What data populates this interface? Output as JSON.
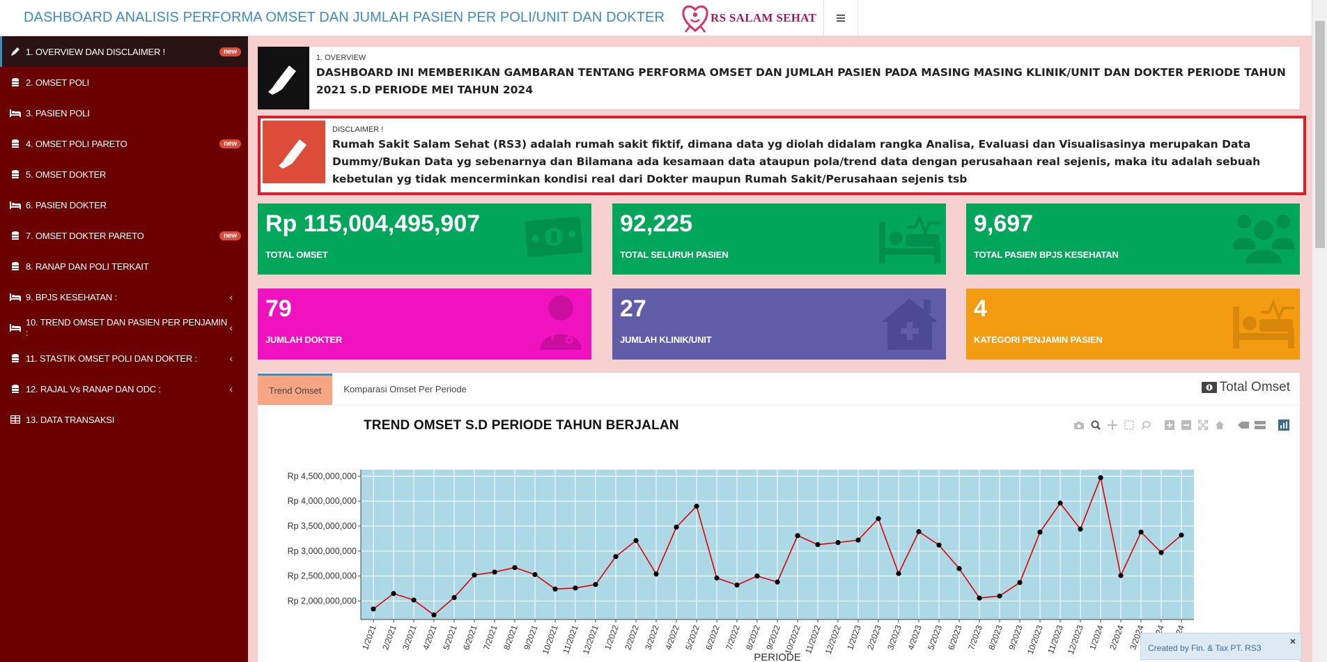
{
  "header": {
    "title": "DASHBOARD ANALISIS PERFORMA OMSET DAN JUMLAH PASIEN PER POLI/UNIT DAN DOKTER",
    "logo_text": "RS SALAM SEHAT",
    "menu_icon": "hamburger-icon"
  },
  "sidebar": {
    "items": [
      {
        "label": "1. OVERVIEW DAN DISCLAIMER !",
        "icon": "pencil-icon",
        "badge": "new"
      },
      {
        "label": "2. OMSET POLI",
        "icon": "coins-icon"
      },
      {
        "label": "3. PASIEN POLI",
        "icon": "bed-icon"
      },
      {
        "label": "4. OMSET POLI PARETO",
        "icon": "coins-icon",
        "badge": "new"
      },
      {
        "label": "5. OMSET DOKTER",
        "icon": "coins-icon"
      },
      {
        "label": "6. PASIEN DOKTER",
        "icon": "bed-icon"
      },
      {
        "label": "7. OMSET DOKTER PARETO",
        "icon": "coins-icon",
        "badge": "new"
      },
      {
        "label": "8. RANAP DAN POLI TERKAIT",
        "icon": "coins-icon"
      },
      {
        "label": "9. BPJS KESEHATAN :",
        "icon": "bed-icon"
      },
      {
        "label": "10. TREND OMSET DAN PASIEN PER PENJAMIN :",
        "icon": "bed-icon"
      },
      {
        "label": "11. STASTIK OMSET POLI DAN DOKTER :",
        "icon": "coins-icon"
      },
      {
        "label": "12. RAJAL Vs RANAP DAN ODC :",
        "icon": "coins-icon"
      },
      {
        "label": "13. DATA TRANSAKSI",
        "icon": "table-icon"
      }
    ]
  },
  "overview": {
    "sub": "1. OVERVIEW",
    "text": "DASHBOARD INI MEMBERIKAN GAMBARAN TENTANG PERFORMA OMSET DAN JUMLAH PASIEN PADA MASING MASING KLINIK/UNIT DAN DOKTER PERIODE TAHUN 2021 S.D PERIODE MEI TAHUN 2024"
  },
  "disclaimer": {
    "sub": "DISCLAIMER !",
    "text": "Rumah Sakit Salam Sehat (RS3) adalah rumah sakit fiktif, dimana data yg diolah didalam rangka Analisa, Evaluasi dan Visualisasinya merupakan Data Dummy/Bukan Data yg sebenarnya dan Bilamana ada kesamaan data ataupun pola/trend data dengan perusahaan real sejenis, maka itu adalah sebuah kebetulan yg tidak mencerminkan kondisi real dari Dokter maupun Rumah Sakit/Perusahaan sejenis tsb"
  },
  "valueboxes": [
    {
      "value": "Rp 115,004,495,907",
      "label": "TOTAL OMSET",
      "color": "#00a65a",
      "icon": "money-icon"
    },
    {
      "value": "92,225",
      "label": "TOTAL SELURUH PASIEN",
      "color": "#00a65a",
      "icon": "bed-pulse-icon"
    },
    {
      "value": "9,697",
      "label": "TOTAL PASIEN BPJS KESEHATAN",
      "color": "#00a65a",
      "icon": "users-icon"
    },
    {
      "value": "79",
      "label": "JUMLAH DOKTER",
      "color": "#f012be",
      "icon": "doctor-icon"
    },
    {
      "value": "27",
      "label": "JUMLAH KLINIK/UNIT",
      "color": "#605ca8",
      "icon": "house-medical-icon"
    },
    {
      "value": "4",
      "label": "KATEGORI PENJAMIN PASIEN",
      "color": "#f39c12",
      "icon": "bed-pulse-icon"
    }
  ],
  "tabs": {
    "items": [
      "Trend Omset",
      "Komparasi Omset Per Periode"
    ],
    "active": "Trend Omset",
    "panel_title": "Total Omset"
  },
  "chart_data": {
    "type": "line",
    "title": "TREND OMSET S.D PERIODE TAHUN BERJALAN",
    "xlabel": "PERIODE",
    "ylabel": "",
    "x": [
      "1/2021",
      "2/2021",
      "3/2021",
      "4/2021",
      "5/2021",
      "6/2021",
      "7/2021",
      "8/2021",
      "9/2021",
      "10/2021",
      "11/2021",
      "12/2021",
      "1/2022",
      "2/2022",
      "3/2022",
      "4/2022",
      "5/2022",
      "6/2022",
      "7/2022",
      "8/2022",
      "9/2022",
      "10/2022",
      "11/2022",
      "12/2022",
      "1/2023",
      "2/2023",
      "3/2023",
      "4/2023",
      "5/2023",
      "6/2023",
      "7/2023",
      "8/2023",
      "9/2023",
      "10/2023",
      "11/2023",
      "12/2023",
      "1/2024",
      "2/2024",
      "3/2024",
      "4/2024",
      "5/2024"
    ],
    "values": [
      1840000000,
      2150000000,
      2020000000,
      1720000000,
      2070000000,
      2520000000,
      2580000000,
      2670000000,
      2530000000,
      2240000000,
      2260000000,
      2330000000,
      2890000000,
      3210000000,
      2540000000,
      3480000000,
      3900000000,
      2460000000,
      2320000000,
      2500000000,
      2380000000,
      3310000000,
      3130000000,
      3170000000,
      3220000000,
      3650000000,
      2550000000,
      3390000000,
      3120000000,
      2650000000,
      2060000000,
      2100000000,
      2370000000,
      3380000000,
      3960000000,
      3440000000,
      4470000000,
      2510000000,
      3380000000,
      2970000000,
      3320000000
    ],
    "yticks": [
      "Rp 2,000,000,000",
      "Rp 2,500,000,000",
      "Rp 3,000,000,000",
      "Rp 3,500,000,000",
      "Rp 4,000,000,000",
      "Rp 4,500,000,000"
    ],
    "ytick_values": [
      2000000000,
      2500000000,
      3000000000,
      3500000000,
      4000000000,
      4500000000
    ],
    "ylim": [
      1630000000,
      4630000000
    ],
    "line_color": "#e00000",
    "marker_color": "#000000",
    "plot_bg": "#add8e6",
    "grid": true
  },
  "toast": {
    "text": "Created by Fin. & Tax PT. RS3",
    "close": "×"
  }
}
